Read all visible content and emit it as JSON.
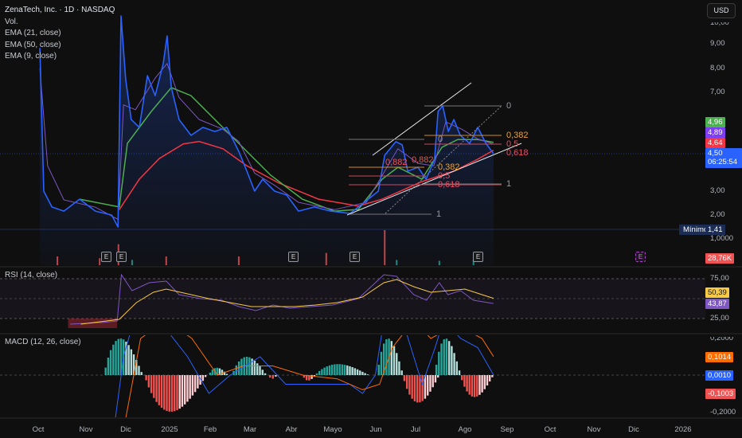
{
  "header": {
    "title": "ZenaTech, Inc. · 1D · NASDAQ",
    "indicators": [
      "Vol.",
      "EMA (21, close)",
      "EMA (50, close)",
      "EMA (9, close)"
    ],
    "currency_button": "USD"
  },
  "rsi_legend": "RSI (14, close)",
  "macd_legend": "MACD (12, 26, close)",
  "colors": {
    "price": "#2962ff",
    "ema21": "#4caf50",
    "ema50": "#f23645",
    "ema9": "#7e57c2",
    "rsi": "#7e57c2",
    "rsi_ma": "#f7c948",
    "macd": "#2962ff",
    "signal": "#ff6d00",
    "hist_up": "#26a69a",
    "hist_down": "#ef5350"
  },
  "price_axis": {
    "ticks": [
      "10,00",
      "9,00",
      "8,00",
      "7,00",
      "3,00",
      "2,00",
      "1,0000"
    ],
    "tags": {
      "ema21": "4,96",
      "ema9": "4,89",
      "ema50": "4,64",
      "last": "4,50",
      "countdown": "06:25:54",
      "min_label": "Mínimo",
      "min_value": "1,41",
      "volume": "28,76K"
    }
  },
  "rsi_axis": {
    "ticks": [
      "75,00",
      "25,00"
    ],
    "tags": {
      "ma": "50,39",
      "rsi": "43,87"
    }
  },
  "macd_axis": {
    "ticks": [
      "0,2000",
      "-0,2000"
    ],
    "tags": {
      "signal": "0,1014",
      "macd": "0,0010",
      "hist": "-0,1003"
    }
  },
  "time_axis": [
    "Oct",
    "Nov",
    "Dic",
    "2025",
    "Feb",
    "Mar",
    "Abr",
    "Mayo",
    "Jun",
    "Jul",
    "Ago",
    "Sep",
    "Oct",
    "Nov",
    "Dic",
    "2026"
  ],
  "earnings_marker": "E",
  "fib_labels": {
    "right": [
      "0",
      "0,382",
      "0,5",
      "0,618"
    ],
    "mid": [
      "0",
      "0,382",
      "0,5",
      "0,618",
      "1"
    ],
    "left": [
      "0,882",
      "0,882",
      "1"
    ]
  },
  "chart_data": {
    "type": "line",
    "title": "ZenaTech, Inc. · 1D · NASDAQ",
    "x_unit": "months since Oct 2024",
    "xlim": [
      0,
      15.5
    ],
    "price_ylim": [
      1,
      10
    ],
    "price": [
      [
        0.04,
        8.84
      ],
      [
        0.13,
        2.96
      ],
      [
        0.32,
        2.31
      ],
      [
        0.6,
        2.14
      ],
      [
        0.97,
        2.63
      ],
      [
        1.34,
        2.14
      ],
      [
        1.72,
        1.98
      ],
      [
        1.87,
        1.49
      ],
      [
        1.94,
        10.15
      ],
      [
        2.05,
        7.54
      ],
      [
        2.18,
        5.9
      ],
      [
        2.37,
        5.58
      ],
      [
        2.56,
        7.7
      ],
      [
        2.74,
        6.88
      ],
      [
        2.93,
        8.19
      ],
      [
        3.02,
        9.33
      ],
      [
        3.12,
        7.21
      ],
      [
        3.3,
        5.9
      ],
      [
        3.58,
        5.25
      ],
      [
        3.86,
        5.58
      ],
      [
        4.14,
        5.41
      ],
      [
        4.42,
        5.58
      ],
      [
        4.7,
        4.59
      ],
      [
        4.89,
        3.78
      ],
      [
        5.07,
        2.96
      ],
      [
        5.26,
        3.45
      ],
      [
        5.54,
        2.96
      ],
      [
        5.82,
        2.8
      ],
      [
        6.1,
        2.14
      ],
      [
        6.47,
        2.31
      ],
      [
        6.85,
        2.14
      ],
      [
        7.31,
        2.05
      ],
      [
        7.69,
        2.57
      ],
      [
        7.97,
        2.96
      ],
      [
        8.12,
        4.43
      ],
      [
        8.38,
        4.99
      ],
      [
        8.53,
        4.86
      ],
      [
        8.66,
        3.78
      ],
      [
        8.9,
        3.94
      ],
      [
        9.09,
        3.45
      ],
      [
        9.29,
        4.27
      ],
      [
        9.37,
        6.23
      ],
      [
        9.48,
        6.46
      ],
      [
        9.61,
        5.41
      ],
      [
        9.74,
        5.9
      ],
      [
        9.89,
        5.25
      ],
      [
        10.11,
        4.92
      ],
      [
        10.3,
        5.58
      ],
      [
        10.49,
        4.92
      ],
      [
        10.67,
        4.5
      ]
    ],
    "ema21": [
      [
        0.97,
        2.63
      ],
      [
        1.9,
        2.31
      ],
      [
        2.09,
        4.92
      ],
      [
        2.65,
        6.23
      ],
      [
        3.12,
        7.21
      ],
      [
        3.58,
        6.88
      ],
      [
        4.14,
        5.9
      ],
      [
        4.7,
        4.92
      ],
      [
        5.45,
        3.61
      ],
      [
        6.19,
        2.63
      ],
      [
        6.94,
        2.14
      ],
      [
        7.5,
        2.21
      ],
      [
        8.06,
        3.45
      ],
      [
        8.43,
        3.94
      ],
      [
        8.99,
        3.45
      ],
      [
        9.46,
        4.76
      ],
      [
        9.83,
        5.08
      ],
      [
        10.3,
        5.08
      ],
      [
        10.67,
        4.96
      ]
    ],
    "ema50": [
      [
        1.9,
        2.2
      ],
      [
        2.37,
        3.45
      ],
      [
        2.84,
        4.3
      ],
      [
        3.4,
        4.9
      ],
      [
        3.77,
        5.0
      ],
      [
        4.33,
        4.7
      ],
      [
        4.89,
        4.0
      ],
      [
        5.63,
        3.3
      ],
      [
        6.57,
        2.63
      ],
      [
        7.5,
        2.35
      ],
      [
        8.06,
        2.63
      ],
      [
        8.99,
        3.35
      ],
      [
        9.74,
        3.78
      ],
      [
        10.3,
        4.27
      ],
      [
        10.67,
        4.64
      ]
    ],
    "ema9": [
      [
        0.04,
        8.0
      ],
      [
        0.22,
        4.0
      ],
      [
        0.6,
        2.6
      ],
      [
        1.34,
        2.3
      ],
      [
        1.87,
        1.8
      ],
      [
        2.0,
        6.5
      ],
      [
        2.28,
        6.3
      ],
      [
        2.74,
        7.6
      ],
      [
        3.02,
        8.2
      ],
      [
        3.3,
        6.8
      ],
      [
        3.77,
        5.9
      ],
      [
        4.33,
        5.5
      ],
      [
        4.7,
        5.0
      ],
      [
        5.07,
        3.7
      ],
      [
        5.54,
        3.2
      ],
      [
        6.1,
        2.5
      ],
      [
        6.94,
        2.2
      ],
      [
        7.69,
        2.5
      ],
      [
        8.06,
        3.6
      ],
      [
        8.43,
        4.7
      ],
      [
        8.9,
        4.1
      ],
      [
        9.27,
        4.0
      ],
      [
        9.55,
        5.8
      ],
      [
        9.93,
        5.5
      ],
      [
        10.3,
        5.1
      ],
      [
        10.67,
        4.89
      ]
    ],
    "volume": [
      [
        0.45,
        0.5,
        0
      ],
      [
        1.44,
        0.4,
        0
      ],
      [
        1.88,
        1.2,
        0
      ],
      [
        2.2,
        0.3,
        1
      ],
      [
        3.0,
        0.5,
        0
      ],
      [
        4.7,
        0.5,
        0
      ],
      [
        6.75,
        0.7,
        0
      ],
      [
        8.12,
        2.0,
        0
      ],
      [
        8.4,
        0.3,
        1
      ],
      [
        9.4,
        0.25,
        1
      ],
      [
        10.2,
        0.3,
        1
      ]
    ],
    "rsi": [
      [
        0.75,
        18
      ],
      [
        1.5,
        20
      ],
      [
        1.85,
        22
      ],
      [
        1.95,
        80
      ],
      [
        2.2,
        60
      ],
      [
        2.6,
        70
      ],
      [
        3.0,
        72
      ],
      [
        3.3,
        55
      ],
      [
        3.8,
        50
      ],
      [
        4.3,
        48
      ],
      [
        4.7,
        40
      ],
      [
        5.1,
        35
      ],
      [
        5.5,
        42
      ],
      [
        5.9,
        38
      ],
      [
        6.4,
        40
      ],
      [
        6.9,
        42
      ],
      [
        7.5,
        50
      ],
      [
        8.1,
        80
      ],
      [
        8.4,
        78
      ],
      [
        8.8,
        55
      ],
      [
        9.1,
        48
      ],
      [
        9.4,
        70
      ],
      [
        9.6,
        55
      ],
      [
        9.9,
        60
      ],
      [
        10.2,
        48
      ],
      [
        10.67,
        43.87
      ]
    ],
    "rsi_ma": [
      [
        1.0,
        18
      ],
      [
        1.9,
        24
      ],
      [
        2.3,
        45
      ],
      [
        2.7,
        58
      ],
      [
        3.0,
        62
      ],
      [
        3.5,
        56
      ],
      [
        4.0,
        50
      ],
      [
        4.5,
        45
      ],
      [
        5.0,
        40
      ],
      [
        5.5,
        40
      ],
      [
        6.0,
        40
      ],
      [
        6.5,
        42
      ],
      [
        7.0,
        45
      ],
      [
        7.6,
        52
      ],
      [
        8.1,
        70
      ],
      [
        8.4,
        74
      ],
      [
        8.8,
        65
      ],
      [
        9.2,
        58
      ],
      [
        9.6,
        60
      ],
      [
        10.0,
        62
      ],
      [
        10.4,
        55
      ],
      [
        10.67,
        50.39
      ]
    ],
    "rsi_ylim": [
      0,
      100
    ],
    "macd": [
      [
        1.8,
        -0.25
      ],
      [
        2.0,
        0.1
      ],
      [
        2.3,
        0.35
      ],
      [
        3.0,
        0.25
      ],
      [
        3.5,
        0.1
      ],
      [
        4.0,
        -0.1
      ],
      [
        4.5,
        0.0
      ],
      [
        5.2,
        0.1
      ],
      [
        5.8,
        -0.05
      ],
      [
        6.5,
        -0.05
      ],
      [
        7.3,
        -0.05
      ],
      [
        7.6,
        -0.1
      ],
      [
        7.9,
        0.0
      ],
      [
        8.1,
        0.3
      ],
      [
        8.6,
        0.25
      ],
      [
        9.0,
        -0.05
      ],
      [
        9.3,
        0.15
      ],
      [
        9.5,
        0.3
      ],
      [
        9.9,
        0.2
      ],
      [
        10.3,
        0.15
      ],
      [
        10.67,
        0.001
      ]
    ],
    "signal": [
      [
        2.0,
        -0.3
      ],
      [
        2.4,
        0.2
      ],
      [
        3.0,
        0.3
      ],
      [
        3.6,
        0.2
      ],
      [
        4.2,
        0.0
      ],
      [
        4.8,
        0.05
      ],
      [
        5.5,
        0.05
      ],
      [
        6.2,
        0.0
      ],
      [
        7.0,
        -0.02
      ],
      [
        7.6,
        -0.08
      ],
      [
        8.0,
        -0.05
      ],
      [
        8.3,
        0.15
      ],
      [
        8.8,
        0.3
      ],
      [
        9.2,
        0.2
      ],
      [
        9.6,
        0.25
      ],
      [
        10.0,
        0.25
      ],
      [
        10.4,
        0.2
      ],
      [
        10.67,
        0.1014
      ]
    ],
    "histogram_segments": [
      [
        1.55,
        2.45,
        0.2
      ],
      [
        2.5,
        3.95,
        -0.2
      ],
      [
        4.0,
        4.45,
        0.04
      ],
      [
        4.55,
        5.35,
        0.1
      ],
      [
        5.4,
        5.6,
        -0.02
      ],
      [
        6.2,
        6.5,
        -0.03
      ],
      [
        6.5,
        7.75,
        0.06
      ],
      [
        7.95,
        8.55,
        0.2
      ],
      [
        8.55,
        9.4,
        -0.15
      ],
      [
        9.3,
        9.9,
        0.2
      ],
      [
        9.9,
        10.67,
        -0.12
      ]
    ],
    "macd_ylim": [
      -0.2,
      0.2
    ]
  }
}
